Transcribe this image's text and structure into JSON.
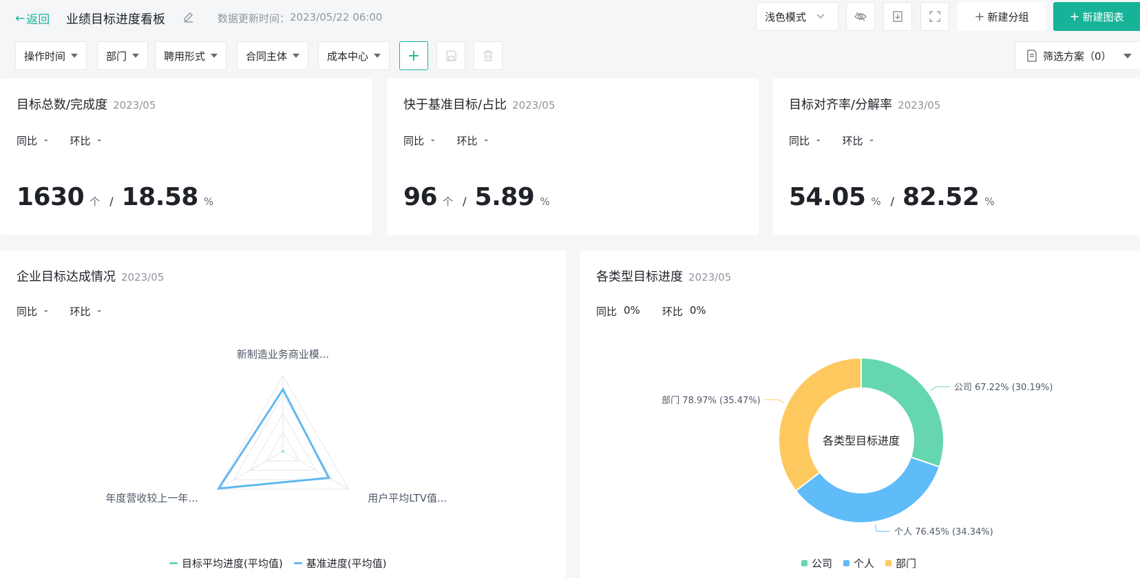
{
  "header": {
    "back_label": "返回",
    "title": "业绩目标进度看板",
    "update_label": "数据更新时间：",
    "update_time": "2023/05/22 06:00",
    "mode_label": "浅色模式",
    "new_group_label": "新建分组",
    "new_chart_label": "新建图表"
  },
  "filters": {
    "items": [
      "操作时间",
      "部门",
      "聘用形式",
      "合同主体",
      "成本中心"
    ],
    "scheme_label": "筛选方案（0）"
  },
  "kpis": [
    {
      "title": "目标总数/完成度",
      "date": "2023/05",
      "yoy_label": "同比",
      "yoy": "-",
      "mom_label": "环比",
      "mom": "-",
      "value1": "1630",
      "unit1": "个",
      "sep": "/",
      "value2": "18.58",
      "unit2": "%"
    },
    {
      "title": "快于基准目标/占比",
      "date": "2023/05",
      "yoy_label": "同比",
      "yoy": "-",
      "mom_label": "环比",
      "mom": "-",
      "value1": "96",
      "unit1": "个",
      "sep": "/",
      "value2": "5.89",
      "unit2": "%"
    },
    {
      "title": "目标对齐率/分解率",
      "date": "2023/05",
      "yoy_label": "同比",
      "yoy": "-",
      "mom_label": "环比",
      "mom": "-",
      "value1": "54.05",
      "unit1": "%",
      "sep": "/",
      "value2": "82.52",
      "unit2": "%"
    }
  ],
  "radar_card": {
    "title": "企业目标达成情况",
    "date": "2023/05",
    "yoy_label": "同比",
    "yoy": "-",
    "mom_label": "环比",
    "mom": "-"
  },
  "donut_card": {
    "title": "各类型目标进度",
    "date": "2023/05",
    "yoy_label": "同比",
    "yoy": "0%",
    "mom_label": "环比",
    "mom": "0%"
  },
  "colors": {
    "accent": "#17b398",
    "green": "#65d6ae",
    "blue": "#5fbcf9",
    "yellow": "#fdc95f",
    "baseline": "#62b8f1"
  },
  "chart_data": [
    {
      "type": "radar",
      "indicators": [
        "新制造业务商业模...",
        "用户平均LTV值...",
        "年度营收较上一年..."
      ],
      "max": 1,
      "series": [
        {
          "name": "目标平均进度(平均值)",
          "values": [
            0.01,
            0.01,
            0.01
          ]
        },
        {
          "name": "基准进度(平均值)",
          "values": [
            0.82,
            0.7,
            0.98
          ]
        }
      ]
    },
    {
      "type": "pie",
      "center_label": "各类型目标进度",
      "slices": [
        {
          "name": "公司",
          "progress": "67.22%",
          "share": "(30.19%)",
          "value": 30.19
        },
        {
          "name": "个人",
          "progress": "76.45%",
          "share": "(34.34%)",
          "value": 34.34
        },
        {
          "name": "部门",
          "progress": "78.97%",
          "share": "(35.47%)",
          "value": 35.47
        }
      ]
    }
  ]
}
